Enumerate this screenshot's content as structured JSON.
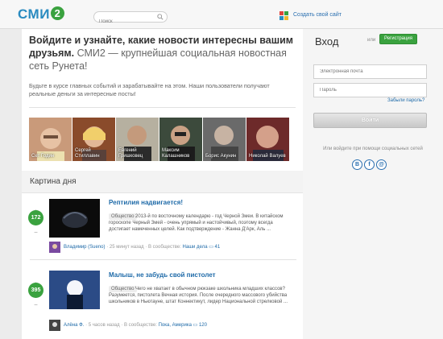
{
  "header": {
    "logo_text": "СМИ",
    "logo_num": "2",
    "search_placeholder": "Поиск",
    "create_site": "Создать свой сайт"
  },
  "promo": {
    "headline_bold": "Войдите и узнайте, какие новости интересны вашим друзьям.",
    "headline_rest": "СМИ2 — крупнейшая социальная новостная сеть Рунета!",
    "subtext": "Будьте в курсе главных событий и зарабатывайте на этом. Наши пользователи получают реальные деньги за интересные посты!",
    "people": [
      {
        "name": "Сет Годин"
      },
      {
        "name": "Сергей Стиллавин"
      },
      {
        "name": "Евгений Гришковец"
      },
      {
        "name": "Максим Калашников"
      },
      {
        "name": "Борис Акунин"
      },
      {
        "name": "Николай Валуев"
      }
    ]
  },
  "section_title": "Картина дня",
  "feed": [
    {
      "votes": "172",
      "title": "Рептилия надвигается!",
      "category": "Общество",
      "text": "2013-й по восточному календарю - год Черной Змеи. В китайском гороскопе Черный Змей - очень упрямый и настойчивый, поэтому всегда достигает намеченных целей. Как подтверждение - Жанна Д'Арк, Аль ...",
      "author": "Владимир (Sueno)",
      "time": "25 минут назад",
      "community_prefix": "В сообществе:",
      "community": "Наши дела",
      "comments": "41"
    },
    {
      "votes": "395",
      "title": "Малыш, не забудь свой пистолет",
      "category": "Общество",
      "text": "Чего не хватает в обычном рюкзаке школьника младших классов? Разумеется, пистолета Вечная история. После очередного массового убийства школьников в Ньютауне, штат Коннектикут, лидер Национальной стрелковой ...",
      "author": "Алёна Ф.",
      "time": "5 часов назад",
      "community_prefix": "В сообществе:",
      "community": "Пока, Америка",
      "comments": "120"
    }
  ],
  "login": {
    "title": "Вход",
    "or": "или",
    "register": "Регистрация",
    "email_placeholder": "Электронная почта",
    "password_placeholder": "Пароль",
    "forgot": "Забыли пароль?",
    "login_button": "Войти",
    "social_text": "Или войдите при помощи социальных сетей",
    "social": [
      "В",
      "f",
      "@"
    ]
  },
  "colors": {
    "brand_blue": "#2a8bc0",
    "green": "#3aa23f",
    "link": "#1e6aa8"
  }
}
